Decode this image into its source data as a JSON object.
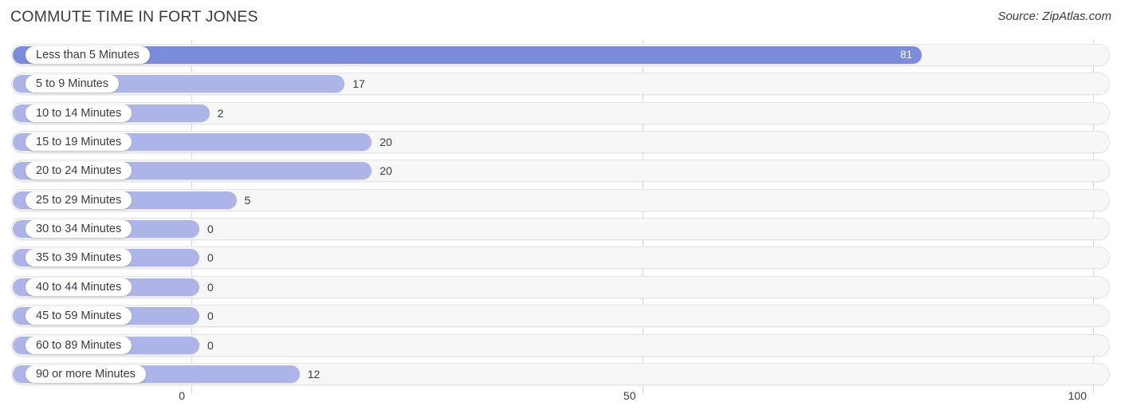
{
  "header": {
    "title": "COMMUTE TIME IN FORT JONES",
    "source": "Source: ZipAtlas.com"
  },
  "colors": {
    "bar": "#adb5e8",
    "bar_highlight": "#7b8cdd",
    "track": "#f7f7f8",
    "gridline": "#d8d8dc",
    "text": "#3a3a44"
  },
  "chart_data": {
    "type": "bar",
    "orientation": "horizontal",
    "title": "COMMUTE TIME IN FORT JONES",
    "subtitle": "",
    "xlabel": "",
    "ylabel": "",
    "xlim": [
      0,
      100
    ],
    "grid": true,
    "legend": false,
    "source": "Source: ZipAtlas.com",
    "tick_labels": [
      "0",
      "50",
      "100"
    ],
    "ticks": [
      0,
      50,
      100
    ],
    "categories": [
      "Less than 5 Minutes",
      "5 to 9 Minutes",
      "10 to 14 Minutes",
      "15 to 19 Minutes",
      "20 to 24 Minutes",
      "25 to 29 Minutes",
      "30 to 34 Minutes",
      "35 to 39 Minutes",
      "40 to 44 Minutes",
      "45 to 59 Minutes",
      "60 to 89 Minutes",
      "90 or more Minutes"
    ],
    "values": [
      81,
      17,
      2,
      20,
      20,
      5,
      0,
      0,
      0,
      0,
      0,
      12
    ],
    "value_labels": [
      "81",
      "17",
      "2",
      "20",
      "20",
      "5",
      "0",
      "0",
      "0",
      "0",
      "0",
      "12"
    ]
  }
}
